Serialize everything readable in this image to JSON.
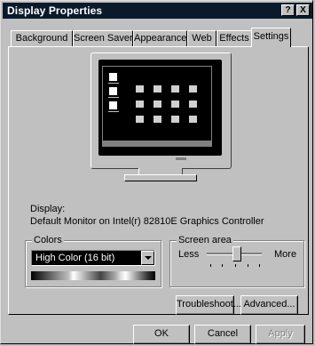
{
  "window": {
    "title": "Display Properties",
    "help_glyph": "?",
    "close_glyph": "X"
  },
  "tabs": [
    {
      "label": "Background"
    },
    {
      "label": "Screen Saver"
    },
    {
      "label": "Appearance"
    },
    {
      "label": "Web"
    },
    {
      "label": "Effects"
    },
    {
      "label": "Settings",
      "active": true
    }
  ],
  "display": {
    "label": "Display:",
    "value": "Default Monitor on Intel(r) 82810E Graphics Controller"
  },
  "colors": {
    "group_label": "Colors",
    "selected": "High Color (16 bit)"
  },
  "screen_area": {
    "group_label": "Screen area",
    "less_label": "Less",
    "more_label": "More",
    "level_fraction": 0.5
  },
  "buttons": {
    "troubleshoot": "Troubleshoot...",
    "advanced": "Advanced...",
    "ok": "OK",
    "cancel": "Cancel",
    "apply": "Apply"
  },
  "colors_theme": {
    "titlebar": "#0a1a2a",
    "dialog_face": "#c0c0c0"
  }
}
